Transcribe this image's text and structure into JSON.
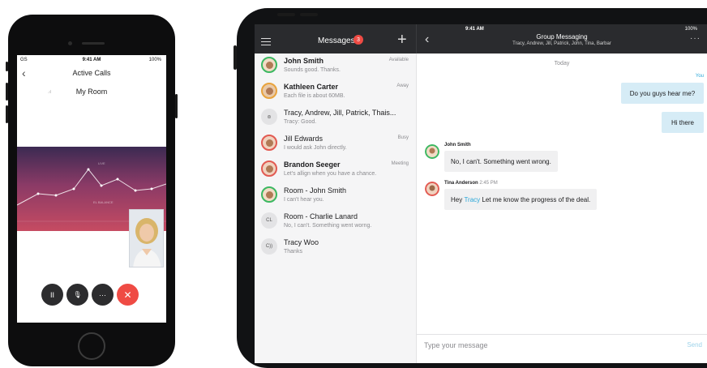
{
  "phone": {
    "status": {
      "carrier": "GS",
      "time": "9:41 AM",
      "battery": "100%"
    },
    "nav": {
      "back_icon": "chevron-left-icon",
      "title": "Active Calls"
    },
    "call": {
      "room_name": "My Room",
      "signal_icon": "signal-icon"
    },
    "graph": {
      "label_top": "LIVE",
      "label_mid": "EL BALANCE",
      "colors": [
        "#3b2a52",
        "#8a3a66",
        "#c64b62"
      ]
    },
    "controls": [
      {
        "name": "pause-button",
        "icon": "pause-icon",
        "glyph": "II"
      },
      {
        "name": "mute-button",
        "icon": "microphone-icon",
        "glyph": "🎙"
      },
      {
        "name": "more-button",
        "icon": "more-icon",
        "glyph": "···"
      },
      {
        "name": "end-call-button",
        "icon": "close-icon",
        "glyph": "✕"
      }
    ]
  },
  "tablet": {
    "status": {
      "time": "9:41 AM",
      "battery": "100%"
    },
    "left_header": {
      "title": "Messages",
      "badge": "3",
      "menu_icon": "menu-icon",
      "add_icon": "plus-icon"
    },
    "right_header": {
      "back_icon": "chevron-left-icon",
      "title": "Group Messaging",
      "subtitle": "Tracy, Andrew, Jill, Patrick, John, Tina, Barbar",
      "more_icon": "more-icon"
    },
    "conversations": [
      {
        "name": "John Smith",
        "preview": "Sounds good. Thanks.",
        "status": "Available",
        "ring": "g"
      },
      {
        "name": "Kathleen Carter",
        "preview": "Each file is about 60MB.",
        "status": "Away",
        "ring": "o"
      },
      {
        "name": "Tracy, Andrew, Jill, Patrick, Thais...",
        "preview": "Tracy: Good.",
        "status": "",
        "ring": "n",
        "initials": "⊜"
      },
      {
        "name": "Jill Edwards",
        "preview": "I would ask John directly.",
        "status": "Busy",
        "ring": "r"
      },
      {
        "name": "Brandon Seeger",
        "preview": "Let's allign when you have a chance.",
        "status": "Meeting",
        "ring": "r"
      },
      {
        "name": "Room - John Smith",
        "preview": "I can't hear you.",
        "status": "",
        "ring": "g"
      },
      {
        "name": "Room - Charlie Lanard",
        "preview": "No, I can't. Something went worng.",
        "status": "",
        "ring": "n",
        "initials": "CL"
      },
      {
        "name": "Tracy Woo",
        "preview": "Thanks",
        "status": "",
        "ring": "n",
        "initials": "C))"
      }
    ],
    "chat": {
      "date_label": "Today",
      "you_label": "You",
      "outgoing": [
        "Do you guys hear me?",
        "Hi there"
      ],
      "incoming": [
        {
          "sender": "John Smith",
          "time": "",
          "text_before": "No, I can't. Something went wrong.",
          "mention": "",
          "text_after": ""
        },
        {
          "sender": "Tina Anderson",
          "time": "2:45 PM",
          "text_before": "Hey ",
          "mention": "Tracy",
          "text_after": " Let me know the progress of the deal."
        }
      ]
    },
    "composer": {
      "placeholder": "Type your message",
      "send_label": "Send"
    },
    "colors": {
      "header_bg": "#2a2b2e",
      "accent": "#2aa7d8",
      "badge": "#ef4b44",
      "end_call": "#ef4b44"
    }
  }
}
